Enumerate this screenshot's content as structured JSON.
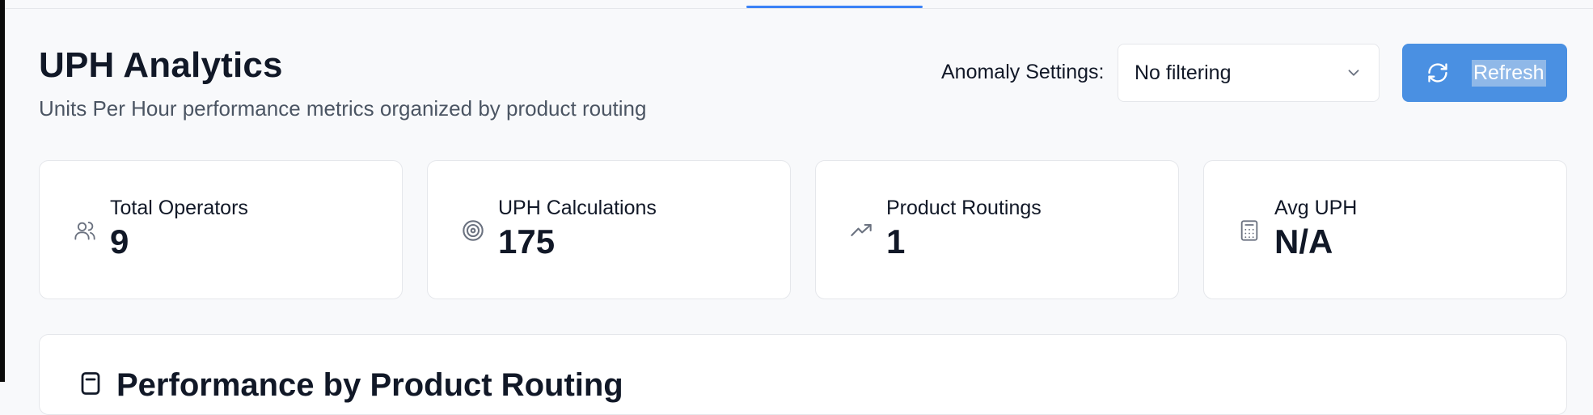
{
  "header": {
    "title": "UPH Analytics",
    "subtitle": "Units Per Hour performance metrics organized by product routing"
  },
  "anomaly": {
    "label": "Anomaly Settings:",
    "selected": "No filtering"
  },
  "refresh": {
    "label": "Refresh"
  },
  "stats": [
    {
      "label": "Total Operators",
      "value": "9",
      "icon": "users-icon"
    },
    {
      "label": "UPH Calculations",
      "value": "175",
      "icon": "target-icon"
    },
    {
      "label": "Product Routings",
      "value": "1",
      "icon": "trending-up-icon"
    },
    {
      "label": "Avg UPH",
      "value": "N/A",
      "icon": "calculator-icon"
    }
  ],
  "panel": {
    "title": "Performance by Product Routing",
    "icon": "document-icon"
  },
  "colors": {
    "accent": "#3b82f6",
    "button": "#4a90e2"
  }
}
